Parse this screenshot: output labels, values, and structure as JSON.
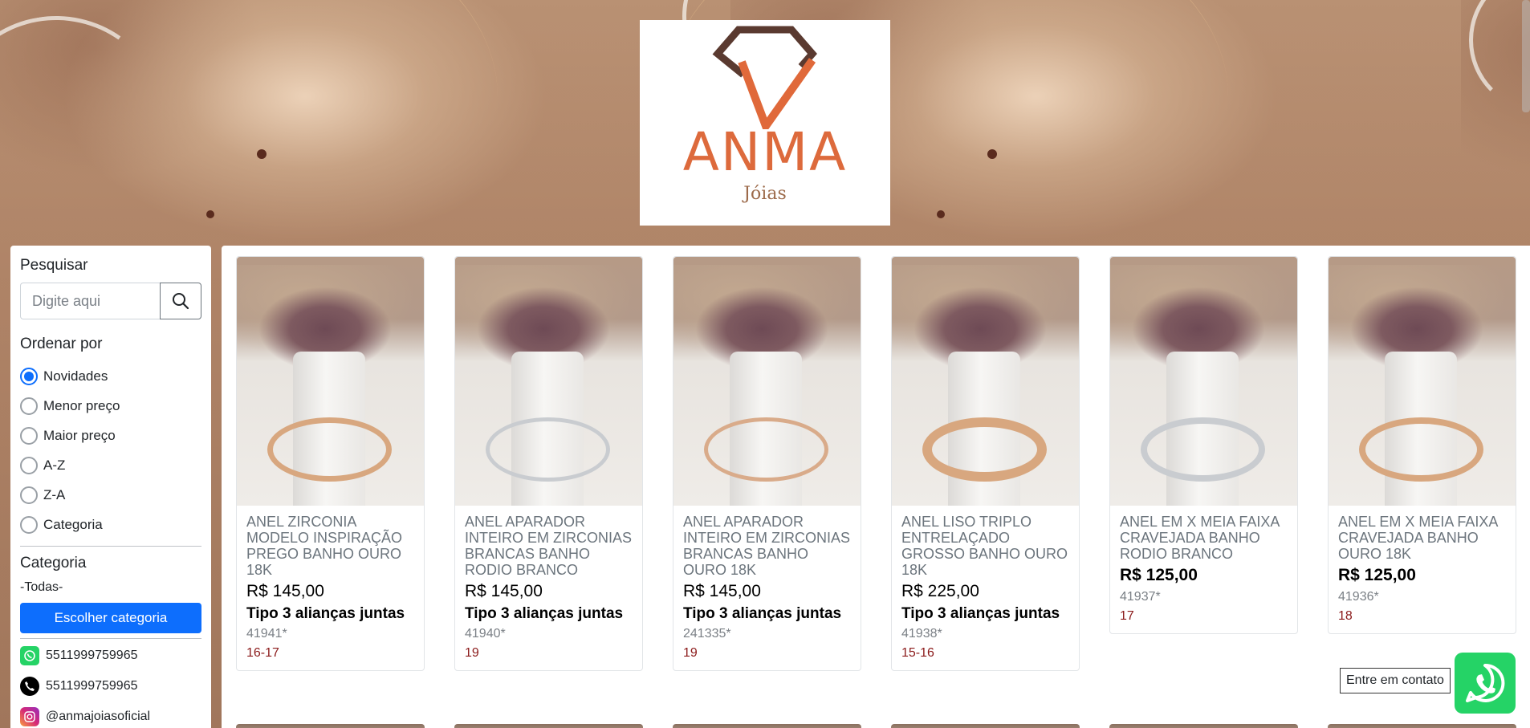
{
  "brand": {
    "name": "ANMA",
    "subtitle": "Jóias",
    "accent": "#dd6a3c"
  },
  "sidebar": {
    "search": {
      "title": "Pesquisar",
      "placeholder": "Digite aqui"
    },
    "sort": {
      "title": "Ordenar por",
      "options": [
        {
          "label": "Novidades",
          "checked": true
        },
        {
          "label": "Menor preço",
          "checked": false
        },
        {
          "label": "Maior preço",
          "checked": false
        },
        {
          "label": "A-Z",
          "checked": false
        },
        {
          "label": "Z-A",
          "checked": false
        },
        {
          "label": "Categoria",
          "checked": false
        }
      ]
    },
    "category": {
      "title": "Categoria",
      "current": "-Todas-",
      "button": "Escolher categoria"
    },
    "contacts": [
      {
        "icon": "whatsapp-icon",
        "text": "5511999759965"
      },
      {
        "icon": "phone-icon",
        "text": "5511999759965"
      },
      {
        "icon": "instagram-icon",
        "text": "@anmajoiasoficial"
      }
    ]
  },
  "products": [
    {
      "name": "ANEL ZIRCONIA MODELO INSPIRAÇÃO PREGO BANHO OURO 18K",
      "price": "R$ 145,00",
      "type": "Tipo 3 alianças juntas",
      "code": "41941*",
      "size": "16-17"
    },
    {
      "name": "ANEL APARADOR INTEIRO EM ZIRCONIAS BRANCAS BANHO RODIO BRANCO",
      "price": "R$ 145,00",
      "type": "Tipo 3 alianças juntas",
      "code": "41940*",
      "size": "19"
    },
    {
      "name": "ANEL APARADOR INTEIRO EM ZIRCONIAS BRANCAS BANHO OURO 18K",
      "price": "R$ 145,00",
      "type": "Tipo 3 alianças juntas",
      "code": "241335*",
      "size": "19"
    },
    {
      "name": "ANEL LISO TRIPLO ENTRELAÇADO GROSSO BANHO OURO 18K",
      "price": "R$ 225,00",
      "type": "Tipo 3 alianças juntas",
      "code": "41938*",
      "size": "15-16"
    },
    {
      "name": "ANEL EM X MEIA FAIXA CRAVEJADA BANHO RODIO BRANCO",
      "price": "R$ 125,00",
      "code": "41937*",
      "size": "17"
    },
    {
      "name": "ANEL EM X MEIA FAIXA CRAVEJADA BANHO OURO 18K",
      "price": "R$ 125,00",
      "code": "41936*",
      "size": "18"
    }
  ],
  "floating": {
    "contact_label": "Entre em contato",
    "icon": "whatsapp-icon",
    "color": "#25d366"
  },
  "colors": {
    "primary": "#0d6efd",
    "size_text": "#8b1a1a"
  }
}
